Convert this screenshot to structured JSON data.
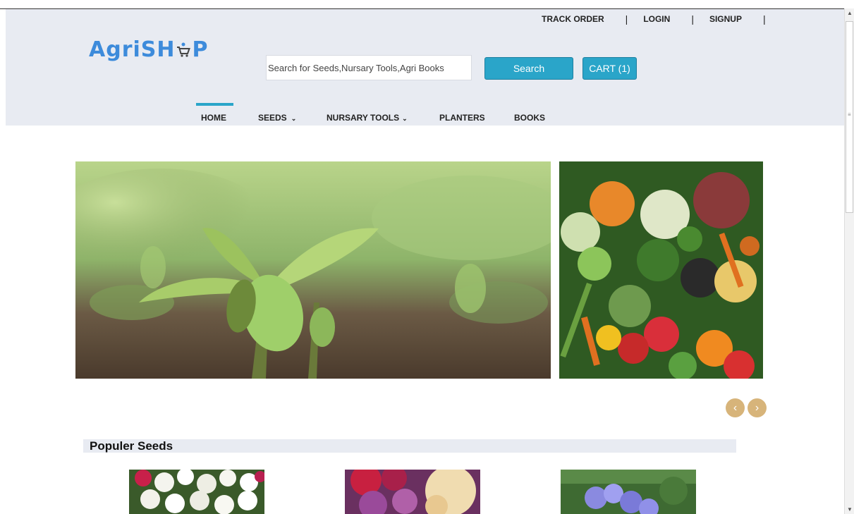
{
  "toplinks": {
    "track_order": "TRACK ORDER",
    "login": "LOGIN",
    "signup": "SIGNUP",
    "separator": "|"
  },
  "logo": {
    "text_before": "AgriSH",
    "text_after": "P"
  },
  "search": {
    "placeholder": "Search for Seeds,Nursary Tools,Agri Books",
    "button_label": "Search"
  },
  "cart": {
    "label": "CART (1)"
  },
  "nav": {
    "items": [
      {
        "label": "HOME",
        "active": true
      },
      {
        "label": "SEEDS",
        "dropdown": true
      },
      {
        "label": "NURSARY TOOLS",
        "dropdown": true
      },
      {
        "label": "PLANTERS"
      },
      {
        "label": "BOOKS"
      }
    ],
    "chevron": "⌄"
  },
  "slider": {
    "prev": "‹",
    "next": "›"
  },
  "section": {
    "title": "Populer Seeds"
  },
  "colors": {
    "accent": "#2aa5c9",
    "header_bg": "#e8ebf2",
    "logo": "#3d8bdb",
    "arrow": "#d7b47a"
  }
}
